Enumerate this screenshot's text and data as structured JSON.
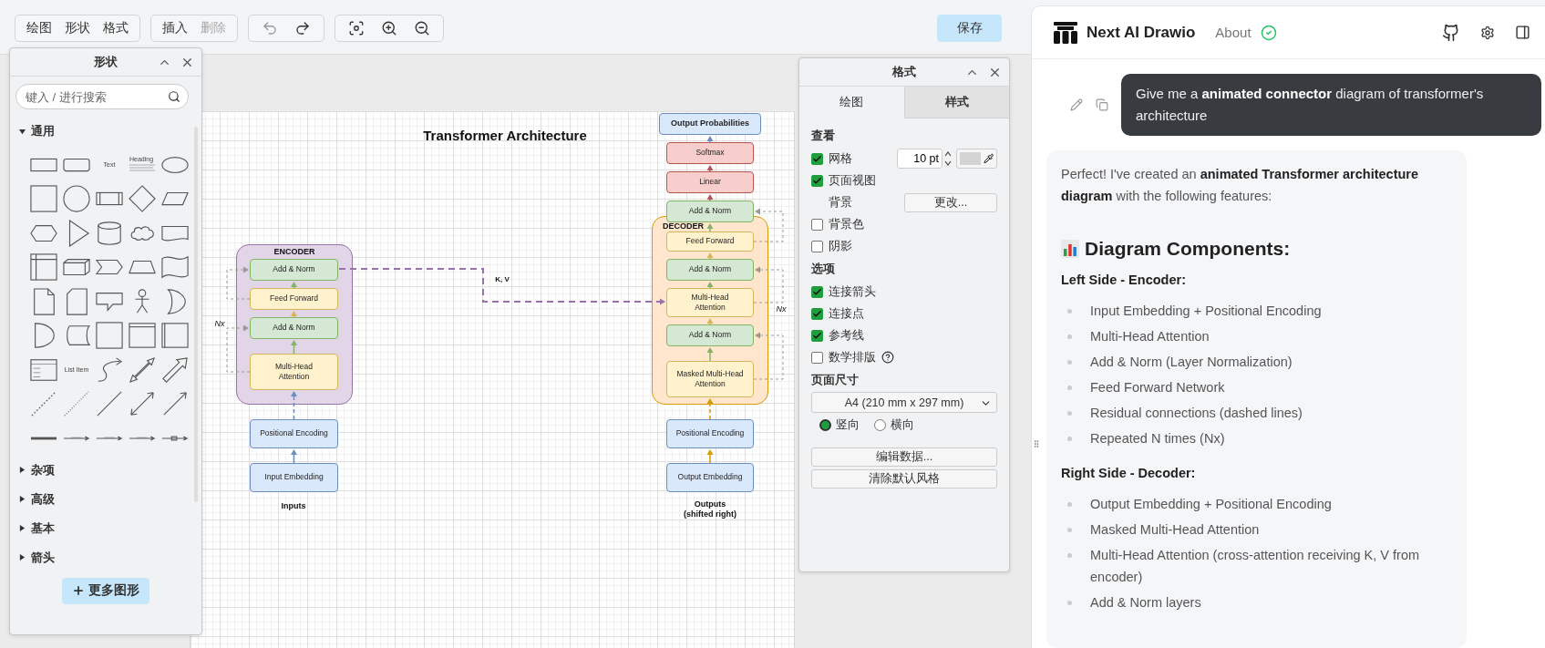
{
  "toolbar": {
    "groups": [
      {
        "buttons": [
          {
            "label": "绘图",
            "disabled": false
          },
          {
            "label": "形状",
            "disabled": false
          },
          {
            "label": "格式",
            "disabled": false
          }
        ]
      },
      {
        "buttons": [
          {
            "label": "插入",
            "disabled": false
          },
          {
            "label": "删除",
            "disabled": true
          }
        ]
      }
    ],
    "icon_groups": [
      {
        "buttons": [
          {
            "kind": "undo",
            "disabled": true
          },
          {
            "kind": "redo",
            "disabled": false
          }
        ]
      },
      {
        "buttons": [
          {
            "kind": "fit",
            "disabled": false
          },
          {
            "kind": "zoom-in",
            "disabled": false
          },
          {
            "kind": "zoom-out",
            "disabled": false
          }
        ]
      }
    ],
    "save": "保存"
  },
  "shapes_panel": {
    "title": "形状",
    "search": {
      "placeholder": "键入 / 进行搜索"
    },
    "sections": [
      {
        "label": "通用",
        "expanded": true
      },
      {
        "label": "杂项",
        "expanded": false
      },
      {
        "label": "高级",
        "expanded": false
      },
      {
        "label": "基本",
        "expanded": false
      },
      {
        "label": "箭头",
        "expanded": false
      }
    ],
    "shapes": [
      {
        "kind": "rect"
      },
      {
        "kind": "rounded"
      },
      {
        "kind": "text",
        "label": "Text"
      },
      {
        "kind": "heading",
        "label": "Heading"
      },
      {
        "kind": "ellipse"
      },
      {
        "kind": "square"
      },
      {
        "kind": "circle"
      },
      {
        "kind": "process"
      },
      {
        "kind": "diamond"
      },
      {
        "kind": "parallelogram"
      },
      {
        "kind": "hexagon"
      },
      {
        "kind": "triangle"
      },
      {
        "kind": "cylinder"
      },
      {
        "kind": "cloud"
      },
      {
        "kind": "document"
      },
      {
        "kind": "storage"
      },
      {
        "kind": "cube"
      },
      {
        "kind": "step"
      },
      {
        "kind": "trapezoid"
      },
      {
        "kind": "tape"
      },
      {
        "kind": "note"
      },
      {
        "kind": "card"
      },
      {
        "kind": "callout"
      },
      {
        "kind": "actor"
      },
      {
        "kind": "or"
      },
      {
        "kind": "and"
      },
      {
        "kind": "datastore"
      },
      {
        "kind": "square"
      },
      {
        "kind": "container"
      },
      {
        "kind": "frame"
      },
      {
        "kind": "table"
      },
      {
        "kind": "text",
        "label": "List Item"
      },
      {
        "kind": "curve"
      },
      {
        "kind": "double-arrow"
      },
      {
        "kind": "block-arrow"
      },
      {
        "kind": "dashed"
      },
      {
        "kind": "dotted"
      },
      {
        "kind": "line"
      },
      {
        "kind": "bidirectional"
      },
      {
        "kind": "arrow"
      },
      {
        "kind": "thick"
      },
      {
        "kind": "connector"
      },
      {
        "kind": "connector"
      },
      {
        "kind": "connector"
      },
      {
        "kind": "connector-box"
      }
    ],
    "more_button": "更多图形"
  },
  "diagram": {
    "title": "Transformer Architecture",
    "blocks": [
      {
        "label": "ENCODER",
        "kind": "encoder"
      },
      {
        "label": "DECODER",
        "kind": "decoder"
      }
    ],
    "nodes": [
      {
        "label": "Add & Norm",
        "kind": "norm"
      },
      {
        "label": "Feed Forward",
        "kind": "feed"
      },
      {
        "label": "Add & Norm",
        "kind": "norm"
      },
      {
        "label": "Multi-Head\nAttention",
        "kind": "feed"
      },
      {
        "label": "Positional Encoding",
        "kind": "embedding"
      },
      {
        "label": "Input Embedding",
        "kind": "embedding"
      },
      {
        "label": "Output Probabilities",
        "kind": "output"
      },
      {
        "label": "Softmax",
        "kind": "linear"
      },
      {
        "label": "Linear",
        "kind": "linear"
      },
      {
        "label": "Add & Norm",
        "kind": "norm"
      },
      {
        "label": "Feed Forward",
        "kind": "feed"
      },
      {
        "label": "Add & Norm",
        "kind": "norm"
      },
      {
        "label": "Multi-Head\nAttention",
        "kind": "feed"
      },
      {
        "label": "Add & Norm",
        "kind": "norm"
      },
      {
        "label": "Masked Multi-Head\nAttention",
        "kind": "feed"
      },
      {
        "label": "Positional Encoding",
        "kind": "embedding"
      },
      {
        "label": "Output Embedding",
        "kind": "embedding"
      }
    ],
    "labels": [
      {
        "text": "K, V",
        "kind": "edge"
      },
      {
        "text": "Nx",
        "kind": "repeat"
      },
      {
        "text": "Nx",
        "kind": "repeat"
      },
      {
        "text": "Inputs",
        "kind": "caption"
      },
      {
        "text": "Outputs\n(shifted right)",
        "kind": "caption"
      }
    ]
  },
  "format_panel": {
    "title": "格式",
    "tabs": [
      {
        "label": "绘图",
        "selected": true
      },
      {
        "label": "样式",
        "selected": false
      }
    ],
    "sections": [
      {
        "heading": "查看",
        "rows": [
          {
            "kind": "checkbox",
            "label": "网格",
            "checked": true,
            "value": "10 pt"
          },
          {
            "kind": "checkbox",
            "label": "页面视图",
            "checked": true
          },
          {
            "kind": "button",
            "label": "背景",
            "button": "更改..."
          },
          {
            "kind": "checkbox",
            "label": "背景色",
            "checked": false
          },
          {
            "kind": "checkbox",
            "label": "阴影",
            "checked": false
          }
        ]
      },
      {
        "heading": "选项",
        "rows": [
          {
            "kind": "checkbox",
            "label": "连接箭头",
            "checked": true
          },
          {
            "kind": "checkbox",
            "label": "连接点",
            "checked": true
          },
          {
            "kind": "checkbox",
            "label": "参考线",
            "checked": true
          },
          {
            "kind": "checkbox",
            "label": "数学排版",
            "checked": false,
            "help": true
          }
        ]
      },
      {
        "heading": "页面尺寸",
        "rows": [
          {
            "kind": "select",
            "value": "A4 (210 mm x 297 mm)"
          },
          {
            "kind": "radio",
            "options": [
              {
                "label": "竖向",
                "selected": true
              },
              {
                "label": "横向",
                "selected": false
              }
            ]
          }
        ]
      }
    ],
    "buttons": [
      "编辑数据...",
      "清除默认风格"
    ]
  },
  "chat": {
    "header": {
      "title": "Next AI Drawio",
      "link": "About"
    },
    "prompt": {
      "text": "Give me a **animated connector** diagram of transformer's architecture"
    },
    "reply": {
      "blocks": [
        {
          "kind": "paragraph",
          "text": "Perfect! I've created an **animated Transformer architecture diagram** with the following features:"
        },
        {
          "kind": "heading",
          "text": "Diagram Components:"
        },
        {
          "kind": "subheading",
          "text": "Left Side - Encoder:"
        },
        {
          "kind": "list",
          "items": [
            "Input Embedding + Positional Encoding",
            "Multi-Head Attention",
            "Add & Norm (Layer Normalization)",
            "Feed Forward Network",
            "Residual connections (dashed lines)",
            "Repeated N times (Nx)"
          ]
        },
        {
          "kind": "subheading",
          "text": "Right Side - Decoder:"
        },
        {
          "kind": "list",
          "items": [
            "Output Embedding + Positional Encoding",
            "Masked Multi-Head Attention",
            "Multi-Head Attention (cross-attention receiving K, V from encoder)",
            "Add & Norm layers"
          ]
        }
      ]
    }
  }
}
